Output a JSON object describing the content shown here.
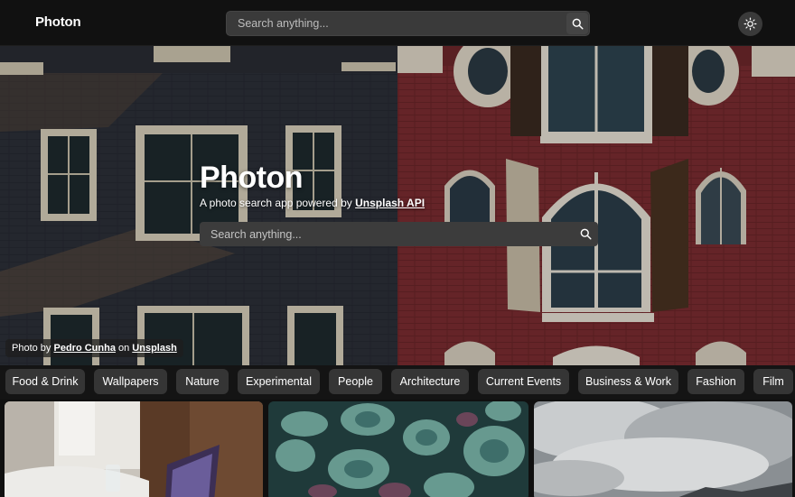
{
  "header": {
    "logo": "Photon",
    "search_placeholder": "Search anything...",
    "search_icon": "search-icon",
    "theme_icon": "sun-icon"
  },
  "hero": {
    "title": "Photon",
    "subtitle_prefix": "A photo search app powered by ",
    "subtitle_link": "Unsplash API",
    "search_placeholder": "Search anything...",
    "credit": {
      "prefix": "Photo by ",
      "author": "Pedro Cunha",
      "middle": " on ",
      "source": "Unsplash"
    }
  },
  "topics": [
    "Food & Drink",
    "Wallpapers",
    "Nature",
    "Experimental",
    "People",
    "Architecture",
    "Current Events",
    "Business & Work",
    "Fashion",
    "Film"
  ],
  "colors": {
    "background": "#101010",
    "header": "#111111",
    "chip": "#353535",
    "search": "#3a3a3a"
  }
}
